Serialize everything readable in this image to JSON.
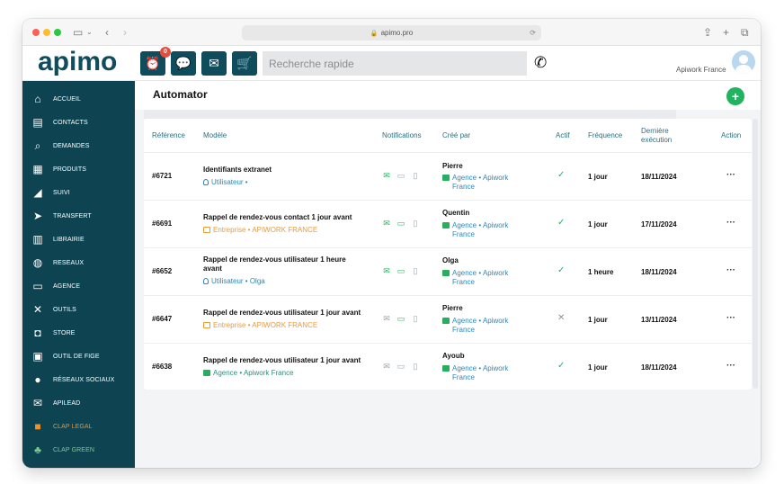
{
  "browser": {
    "url": "apimo.pro"
  },
  "header": {
    "logo": "apimo",
    "alert_badge": "0",
    "search_placeholder": "Recherche rapide",
    "user_name": "Apiwork France"
  },
  "sidebar": {
    "items": [
      {
        "label": "ACCUEIL",
        "icon": "home-icon"
      },
      {
        "label": "CONTACTS",
        "icon": "contacts-icon"
      },
      {
        "label": "DEMANDES",
        "icon": "demandes-icon"
      },
      {
        "label": "PRODUITS",
        "icon": "produits-icon"
      },
      {
        "label": "SUIVI",
        "icon": "chart-icon"
      },
      {
        "label": "TRANSFERT",
        "icon": "send-icon"
      },
      {
        "label": "LIBRAIRIE",
        "icon": "document-icon"
      },
      {
        "label": "RESEAUX",
        "icon": "globe-icon"
      },
      {
        "label": "AGENCE",
        "icon": "store-icon"
      },
      {
        "label": "OUTILS",
        "icon": "tools-icon"
      },
      {
        "label": "STORE",
        "icon": "bag-icon"
      },
      {
        "label": "OUTIL DE FIGE",
        "icon": "card-icon"
      },
      {
        "label": "RÉSEAUX SOCIAUX",
        "icon": "facebook-icon"
      },
      {
        "label": "APILEAD",
        "icon": "mail-icon"
      },
      {
        "label": "CLAP LEGAL",
        "icon": "legal-icon"
      },
      {
        "label": "CLAP GREEN",
        "icon": "green-icon"
      }
    ]
  },
  "main": {
    "title": "Automator",
    "add_label": "+",
    "columns": {
      "reference": "Référence",
      "model": "Modèle",
      "notifications": "Notifications",
      "created_by": "Créé par",
      "active": "Actif",
      "frequency": "Fréquence",
      "last_run": "Dernière exécution",
      "action": "Action"
    },
    "rows": [
      {
        "ref": "#6721",
        "model": "Identifiants extranet",
        "model_line2": "",
        "scope_type": "user",
        "scope": "Utilisateur •",
        "notif": [
          "on",
          "off",
          "off"
        ],
        "creator": "Pierre",
        "creator_sub1": "Agence • Apiwork",
        "creator_sub2": "France",
        "active": "check",
        "frequency": "1 jour",
        "last_run": "18/11/2024",
        "action": "···"
      },
      {
        "ref": "#6691",
        "model": "Rappel de rendez-vous contact 1 jour avant",
        "model_line2": "",
        "scope_type": "ent",
        "scope": "Entreprise • APIWORK FRANCE",
        "notif": [
          "on",
          "on",
          "off"
        ],
        "creator": "Quentin",
        "creator_sub1": "Agence • Apiwork",
        "creator_sub2": "France",
        "active": "check",
        "frequency": "1 jour",
        "last_run": "17/11/2024",
        "action": "···"
      },
      {
        "ref": "#6652",
        "model": "Rappel de rendez-vous utilisateur 1 heure",
        "model_line2": "avant",
        "scope_type": "user",
        "scope": "Utilisateur • Olga",
        "notif": [
          "on",
          "on",
          "off"
        ],
        "creator": "Olga",
        "creator_sub1": "Agence • Apiwork",
        "creator_sub2": "France",
        "active": "check",
        "frequency": "1 heure",
        "last_run": "18/11/2024",
        "action": "···"
      },
      {
        "ref": "#6647",
        "model": "Rappel de rendez-vous utilisateur 1 jour avant",
        "model_line2": "",
        "scope_type": "ent",
        "scope": "Entreprise • APIWORK FRANCE",
        "notif": [
          "off",
          "on",
          "off"
        ],
        "creator": "Pierre",
        "creator_sub1": "Agence • Apiwork",
        "creator_sub2": "France",
        "active": "cross",
        "frequency": "1 jour",
        "last_run": "13/11/2024",
        "action": "···"
      },
      {
        "ref": "#6638",
        "model": "Rappel de rendez-vous utilisateur 1 jour avant",
        "model_line2": "",
        "scope_type": "agency",
        "scope": "Agence • Apiwork France",
        "notif": [
          "off",
          "off",
          "off"
        ],
        "creator": "Ayoub",
        "creator_sub1": "Agence • Apiwork",
        "creator_sub2": "France",
        "active": "check",
        "frequency": "1 jour",
        "last_run": "18/11/2024",
        "action": "···"
      }
    ]
  }
}
